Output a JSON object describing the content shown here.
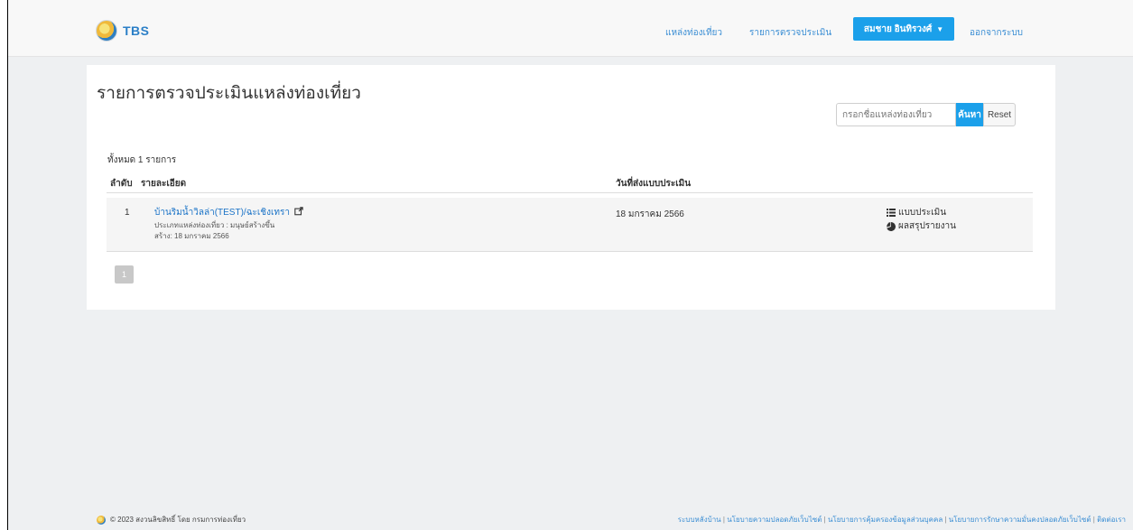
{
  "brand": {
    "name": "TBS"
  },
  "nav": {
    "attractions": "แหล่งท่องเที่ยว",
    "assessments": "รายการตรวจประเมิน",
    "user": "สมชาย อินทิรวงศ์",
    "logout": "ออกจากระบบ"
  },
  "page": {
    "title": "รายการตรวจประเมินแหล่งท่องเที่ยว",
    "total": "ทั้งหมด 1 รายการ"
  },
  "search": {
    "placeholder": "กรอกชื่อแหล่งท่องเที่ยว",
    "button": "ค้นหา",
    "reset": "Reset"
  },
  "table": {
    "headers": {
      "no": "ลำดับ",
      "detail": "รายละเอียด",
      "date": "วันที่ส่งแบบประเมิน"
    },
    "rows": [
      {
        "no": "1",
        "name": "บ้านริมน้ำวิลล่า(TEST)/ฉะเชิงเทรา",
        "type_line": "ประเภทแหล่งท่องเที่ยว : มนุษย์สร้างขึ้น",
        "created_line": "สร้าง: 18 มกราคม 2566",
        "submitted": "18 มกราคม 2566",
        "action_form": "แบบประเมิน",
        "action_report": "ผลสรุปรายงาน"
      }
    ]
  },
  "pagination": {
    "current": "1"
  },
  "footer": {
    "copyright": "© 2023 สงวนลิขสิทธิ์ โดย กรมการท่องเที่ยว",
    "links": [
      "ระบบหลังบ้าน",
      "นโยบายความปลอดภัยเว็บไซต์",
      "นโยบายการคุ้มครองข้อมูลส่วนบุคคล",
      "นโยบายการรักษาความมั่นคงปลอดภัยเว็บไซต์",
      "ติดต่อเรา"
    ]
  },
  "colors": {
    "accent": "#1ba0ea",
    "link": "#1a73c7",
    "background": "#eef0f2"
  },
  "icons": [
    "external-link-icon",
    "list-icon",
    "pie-chart-icon"
  ]
}
